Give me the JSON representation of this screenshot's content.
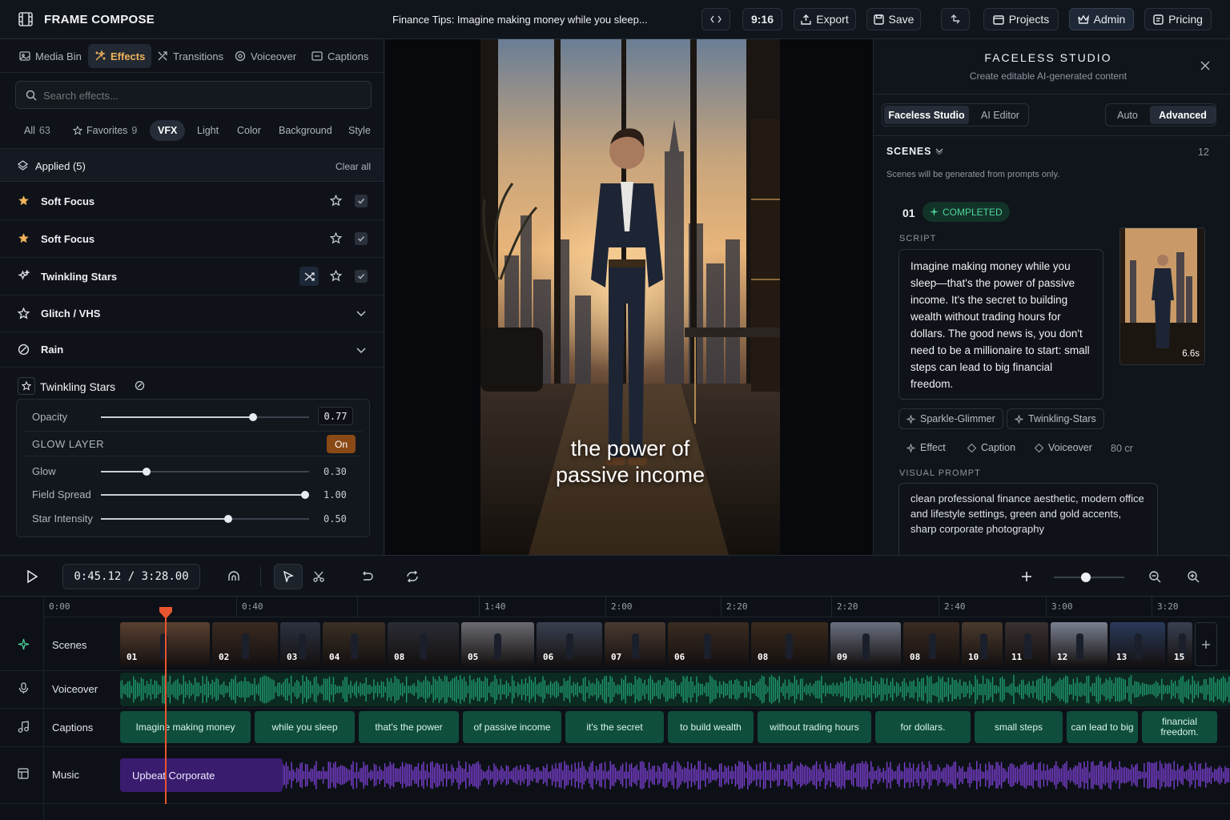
{
  "app": {
    "title": "FRAME COMPOSE",
    "project_title": "Finance Tips: Imagine making money while you sleep..."
  },
  "topbar": {
    "aspect": "9:16",
    "export_label": "Export",
    "save_label": "Save",
    "projects_label": "Projects",
    "admin_label": "Admin",
    "pricing_label": "Pricing"
  },
  "left_tabs": [
    {
      "label": "Media Bin",
      "icon": "media-icon"
    },
    {
      "label": "Effects",
      "icon": "effects-icon"
    },
    {
      "label": "Transitions",
      "icon": "transitions-icon"
    },
    {
      "label": "Voiceover",
      "icon": "voiceover-icon"
    },
    {
      "label": "Captions",
      "icon": "captions-icon"
    }
  ],
  "search": {
    "placeholder": "Search effects..."
  },
  "filters": [
    {
      "label": "All",
      "count": "63"
    },
    {
      "label": "Favorites",
      "count": "9"
    },
    {
      "label": "VFX",
      "count": ""
    },
    {
      "label": "Light",
      "count": ""
    },
    {
      "label": "Color",
      "count": ""
    },
    {
      "label": "Background",
      "count": ""
    },
    {
      "label": "Style",
      "count": ""
    }
  ],
  "applied": {
    "label": "Applied (5)",
    "clear_label": "Clear all"
  },
  "effects": [
    {
      "name": "Soft Focus",
      "icon": "star-filled-icon"
    },
    {
      "name": "Soft Focus",
      "icon": "star-filled-icon"
    },
    {
      "name": "Twinkling Stars",
      "icon": "sparkle-icon"
    },
    {
      "name": "Glitch / VHS",
      "icon": "star-outline-icon"
    },
    {
      "name": "Rain",
      "icon": "rain-icon"
    }
  ],
  "effect_settings": {
    "title": "Twinkling Stars",
    "opacity_label": "Opacity",
    "opacity_value": "0.77",
    "opacity_level": 0.73,
    "glow_layer_label": "GLOW LAYER",
    "glow_layer_state": "On",
    "glow_label": "Glow",
    "glow_value": "0.30",
    "glow_level": 0.22,
    "spread_label": "Field Spread",
    "spread_value": "1.00",
    "spread_level": 0.98,
    "intensity_label": "Star Intensity",
    "intensity_value": "0.50",
    "intensity_level": 0.61
  },
  "preview": {
    "caption_line1": "the power of",
    "caption_line2": "passive income"
  },
  "studio": {
    "title": "FACELESS STUDIO",
    "subtitle": "Create editable AI-generated content",
    "mode_tabs": [
      "Faceless Studio",
      "AI Editor"
    ],
    "gen_tabs": [
      "Auto",
      "Advanced"
    ],
    "scenes_label": "SCENES",
    "scenes_count": "12",
    "scenes_note": "Scenes will be generated from prompts only.",
    "scene_number": "01",
    "scene_status": "COMPLETED",
    "script_label": "SCRIPT",
    "script_text": "Imagine making money while you sleep—that's the power of passive income. It's the secret to building wealth without trading hours for dollars. The good news is, you don't need to be a millionaire to start: small steps can lead to big financial freedom.",
    "thumb_duration": "6.6s",
    "tags": [
      "Sparkle-Glimmer",
      "Twinkling-Stars"
    ],
    "actions": [
      "Effect",
      "Caption",
      "Voiceover"
    ],
    "credits": "80 cr",
    "visual_prompt_label": "VISUAL PROMPT",
    "visual_prompt_text": "clean professional finance aesthetic, modern office and lifestyle settings, green and gold accents, sharp corporate photography"
  },
  "timeline": {
    "timecode": "0:45.12 / 3:28.00",
    "ticks": [
      "0:00",
      "0:40",
      "1:40",
      "2:00",
      "2:20",
      "2:20",
      "2:40",
      "3:00",
      "3:20"
    ],
    "tracks": [
      "Scenes",
      "Voiceover",
      "Captions",
      "Music"
    ],
    "scene_numbers": [
      "01",
      "02",
      "03",
      "04",
      "08",
      "05",
      "06",
      "07",
      "06",
      "08",
      "09",
      "08",
      "10",
      "11",
      "12",
      "13",
      "15"
    ],
    "captions": [
      "Imagine making money",
      "while you sleep",
      "that's the power",
      "of passive income",
      "it's the secret",
      "to build wealth",
      "without trading hours",
      "for dollars.",
      "small steps",
      "can lead to big",
      "financial freedom."
    ],
    "music_label": "Upbeat Corporate"
  },
  "colors": {
    "accent": "#f0b35a",
    "playhead": "#e8552f",
    "caption_green": "#0f4d3c",
    "voice_wave": "#1f9a6c",
    "music_purple": "#7a3fd0"
  }
}
